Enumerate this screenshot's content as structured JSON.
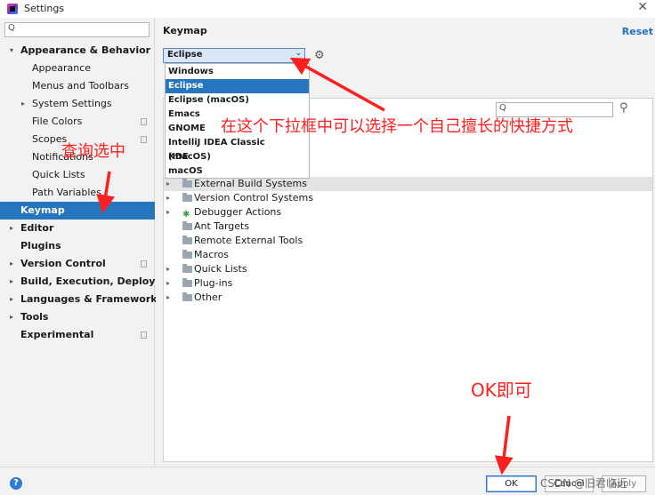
{
  "window": {
    "title": "Settings",
    "close": "✕"
  },
  "search": {
    "glyph": "Q",
    "placeholder": ""
  },
  "sidebar": {
    "items": [
      {
        "label": "Appearance & Behavior",
        "bold": true,
        "arrow": "▾",
        "indent": 0
      },
      {
        "label": "Appearance",
        "indent": 1
      },
      {
        "label": "Menus and Toolbars",
        "indent": 1
      },
      {
        "label": "System Settings",
        "indent": 1,
        "arrow": "▸"
      },
      {
        "label": "File Colors",
        "indent": 1,
        "copy": true
      },
      {
        "label": "Scopes",
        "indent": 1,
        "copy": true
      },
      {
        "label": "Notifications",
        "indent": 1
      },
      {
        "label": "Quick Lists",
        "indent": 1
      },
      {
        "label": "Path Variables",
        "indent": 1
      },
      {
        "label": "Keymap",
        "bold": true,
        "indent": 0,
        "selected": true
      },
      {
        "label": "Editor",
        "bold": true,
        "indent": 0,
        "arrow": "▸"
      },
      {
        "label": "Plugins",
        "bold": true,
        "indent": 0
      },
      {
        "label": "Version Control",
        "bold": true,
        "indent": 0,
        "arrow": "▸",
        "copy": true
      },
      {
        "label": "Build, Execution, Deployment",
        "bold": true,
        "indent": 0,
        "arrow": "▸"
      },
      {
        "label": "Languages & Frameworks",
        "bold": true,
        "indent": 0,
        "arrow": "▸"
      },
      {
        "label": "Tools",
        "bold": true,
        "indent": 0,
        "arrow": "▸"
      },
      {
        "label": "Experimental",
        "bold": true,
        "indent": 0,
        "copy": true
      }
    ]
  },
  "keymap": {
    "title": "Keymap",
    "reset": "Reset",
    "selected": "Eclipse",
    "combo_arrow": "⌄",
    "gear": "⚙",
    "options": [
      {
        "label": "Windows"
      },
      {
        "label": "Eclipse",
        "selected": true
      },
      {
        "label": "Eclipse (macOS)"
      },
      {
        "label": "Emacs"
      },
      {
        "label": "GNOME"
      },
      {
        "label": "IntelliJ IDEA Classic (macOS)"
      },
      {
        "label": "KDE"
      },
      {
        "label": "macOS"
      }
    ]
  },
  "filter": {
    "glyph": "Q",
    "find_glyph": "⚲"
  },
  "tree": {
    "rows": [
      {
        "label": "External Build Systems",
        "arrow": "▸",
        "icon": "folder",
        "highlight": true
      },
      {
        "label": "Version Control Systems",
        "arrow": "▸",
        "icon": "folder"
      },
      {
        "label": "Debugger Actions",
        "arrow": "▸",
        "icon": "bug"
      },
      {
        "label": "Ant Targets",
        "icon": "folder"
      },
      {
        "label": "Remote External Tools",
        "icon": "folder"
      },
      {
        "label": "Macros",
        "icon": "folder"
      },
      {
        "label": "Quick Lists",
        "arrow": "▸",
        "icon": "folder"
      },
      {
        "label": "Plug-ins",
        "arrow": "▸",
        "icon": "folder"
      },
      {
        "label": "Other",
        "arrow": "▸",
        "icon": "folder"
      }
    ]
  },
  "footer": {
    "help": "?",
    "ok": "OK",
    "cancel": "Cancel",
    "apply": "Apply",
    "watermark": "CSDN @旧君临近"
  },
  "annotations": {
    "select_hint": "查询选中",
    "dropdown_hint": "在这个下拉框中可以选择一个自己擅长的快捷方式",
    "ok_hint": "OK即可"
  },
  "colors": {
    "selection": "#2675bf",
    "annotation": "#ff1f1f",
    "link": "#2470c3"
  }
}
